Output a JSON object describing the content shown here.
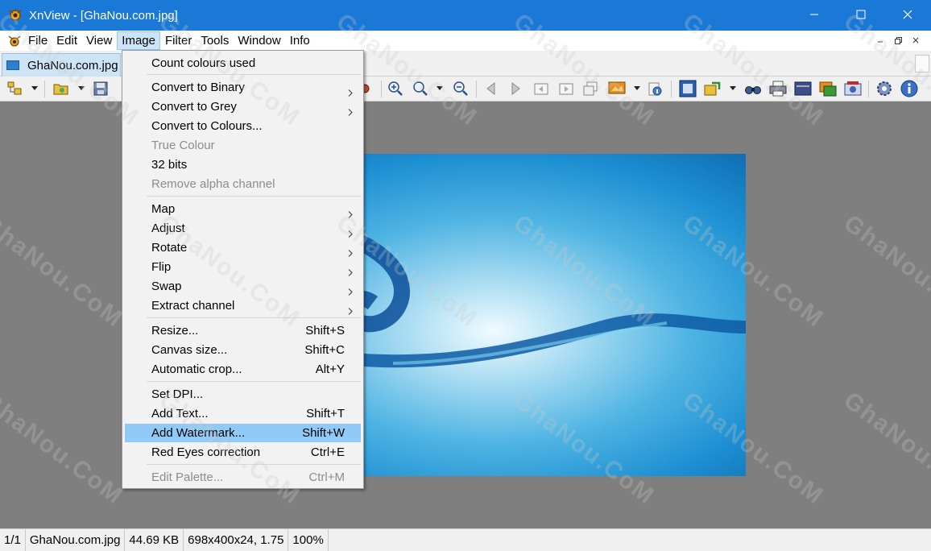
{
  "window": {
    "title": "XnView - [GhaNou.com.jpg]",
    "minimize_icon": "minimize-icon",
    "maximize_icon": "maximize-icon",
    "close_icon": "close-icon"
  },
  "menubar": {
    "items": [
      "File",
      "Edit",
      "View",
      "Image",
      "Filter",
      "Tools",
      "Window",
      "Info"
    ],
    "active": "Image"
  },
  "tabs": [
    {
      "label": "GhaNou.com.jpg",
      "active": true
    }
  ],
  "toolbar": {
    "icons": [
      "browser-icon",
      "open-folder-icon",
      "save-icon",
      "zoom-in-icon",
      "zoom-fit-icon",
      "zoom-out-icon",
      "previous-icon",
      "next-icon",
      "first-page-icon",
      "next-page-icon",
      "pages-icon",
      "wallpaper-icon",
      "properties-icon",
      "fullscreen-icon",
      "export-icon",
      "find-icon",
      "print-icon",
      "scan-icon",
      "slideshow-icon",
      "capture-icon",
      "settings-icon",
      "info-icon"
    ]
  },
  "image_menu": {
    "items": [
      {
        "label": "Count colours used",
        "shortcut": "",
        "submenu": false,
        "disabled": false
      },
      {
        "label": "Convert to Binary",
        "shortcut": "",
        "submenu": true,
        "disabled": false
      },
      {
        "label": "Convert to Grey",
        "shortcut": "",
        "submenu": true,
        "disabled": false
      },
      {
        "label": "Convert to Colours...",
        "shortcut": "",
        "submenu": false,
        "disabled": false
      },
      {
        "label": "True Colour",
        "shortcut": "",
        "submenu": false,
        "disabled": true
      },
      {
        "label": "32 bits",
        "shortcut": "",
        "submenu": false,
        "disabled": false
      },
      {
        "label": "Remove alpha channel",
        "shortcut": "",
        "submenu": false,
        "disabled": true
      },
      {
        "label": "Map",
        "shortcut": "",
        "submenu": true,
        "disabled": false
      },
      {
        "label": "Adjust",
        "shortcut": "",
        "submenu": true,
        "disabled": false
      },
      {
        "label": "Rotate",
        "shortcut": "",
        "submenu": true,
        "disabled": false
      },
      {
        "label": "Flip",
        "shortcut": "",
        "submenu": true,
        "disabled": false
      },
      {
        "label": "Swap",
        "shortcut": "",
        "submenu": true,
        "disabled": false
      },
      {
        "label": "Extract channel",
        "shortcut": "",
        "submenu": true,
        "disabled": false
      },
      {
        "label": "Resize...",
        "shortcut": "Shift+S",
        "submenu": false,
        "disabled": false
      },
      {
        "label": "Canvas size...",
        "shortcut": "Shift+C",
        "submenu": false,
        "disabled": false
      },
      {
        "label": "Automatic crop...",
        "shortcut": "Alt+Y",
        "submenu": false,
        "disabled": false
      },
      {
        "label": "Set DPI...",
        "shortcut": "",
        "submenu": false,
        "disabled": false
      },
      {
        "label": "Add Text...",
        "shortcut": "Shift+T",
        "submenu": false,
        "disabled": false
      },
      {
        "label": "Add Watermark...",
        "shortcut": "Shift+W",
        "submenu": false,
        "disabled": false,
        "highlighted": true
      },
      {
        "label": "Red Eyes correction",
        "shortcut": "Ctrl+E",
        "submenu": false,
        "disabled": false
      },
      {
        "label": "Edit Palette...",
        "shortcut": "Ctrl+M",
        "submenu": false,
        "disabled": true
      }
    ]
  },
  "statusbar": {
    "page": "1/1",
    "filename": "GhaNou.com.jpg",
    "filesize": "44.69 KB",
    "dimensions": "698x400x24, 1.75",
    "zoom": "100%"
  },
  "watermark": {
    "text": "GhaNou.CoM"
  },
  "colors": {
    "titlebar": "#1a78d7",
    "menu_highlight": "#91c9f7",
    "canvas_background": "#7f7f7f"
  }
}
